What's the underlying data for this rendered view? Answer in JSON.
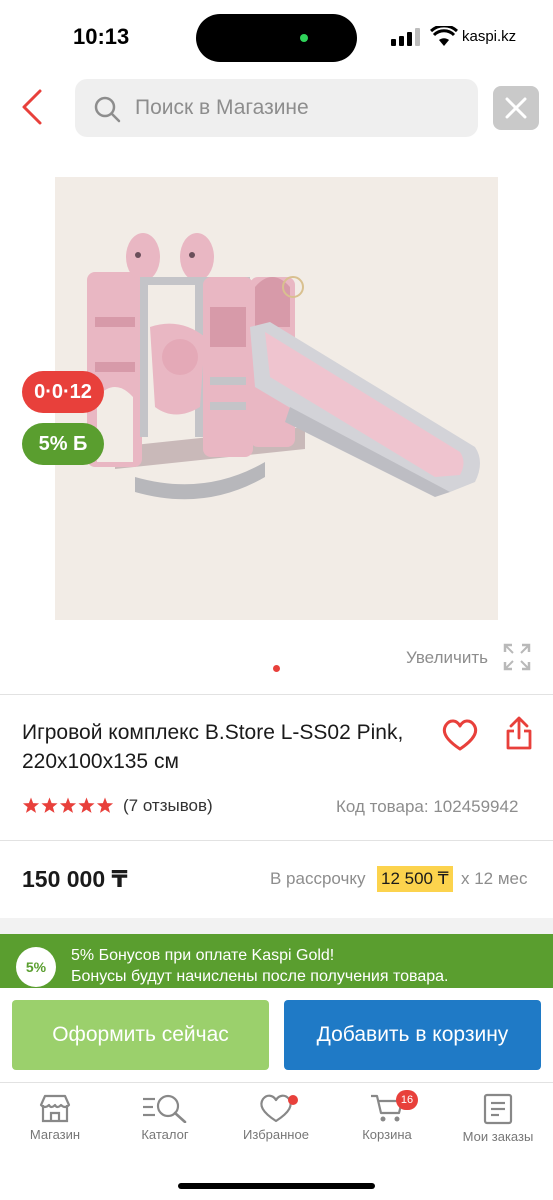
{
  "status_bar": {
    "time": "10:13",
    "carrier": "kaspi.kz"
  },
  "search": {
    "placeholder": "Поиск в Магазине"
  },
  "product": {
    "badges": {
      "installment": "0·0·12",
      "bonus": "5% Б"
    },
    "zoom_label": "Увеличить",
    "title": "Игровой комплекс B.Store L-SS02 Pink, 220x100x135 см",
    "rating_stars": 5,
    "reviews": "(7 отзывов)",
    "code": "Код товара: 102459942",
    "price": "150 000 ₸",
    "installment": {
      "prefix": "В рассрочку",
      "amount": "12 500 ₸",
      "suffix": "x 12 мес"
    }
  },
  "bonus_banner": {
    "circle": "5%",
    "line1": "5% Бонусов при оплате Kaspi Gold!",
    "line2": "Бонусы будут начислены после получения товара."
  },
  "actions": {
    "buy_now": "Оформить сейчас",
    "add_to_cart": "Добавить в корзину"
  },
  "tab_bar": {
    "items": [
      {
        "label": "Магазин",
        "icon": "store-icon"
      },
      {
        "label": "Каталог",
        "icon": "catalog-icon"
      },
      {
        "label": "Избранное",
        "icon": "heart-icon"
      },
      {
        "label": "Корзина",
        "icon": "cart-icon",
        "badge": "16"
      },
      {
        "label": "Мои заказы",
        "icon": "orders-icon"
      }
    ]
  },
  "colors": {
    "accent_red": "#e8403b",
    "bonus_green": "#5a9e2f",
    "primary_blue": "#1f7ac6",
    "buy_now_green": "#9bd06c",
    "installment_yellow": "#fcd34d"
  }
}
